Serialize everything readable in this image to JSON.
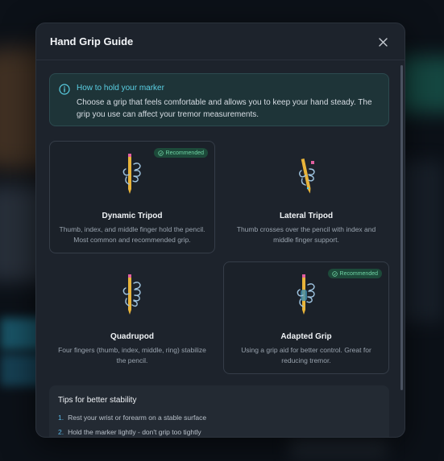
{
  "modal": {
    "title": "Hand Grip Guide",
    "close_icon": "close-icon"
  },
  "info": {
    "icon": "info-icon",
    "title": "How to hold your marker",
    "text": "Choose a grip that feels comfortable and allows you to keep your hand steady. The grip you use can affect your tremor measurements."
  },
  "grips": [
    {
      "title": "Dynamic Tripod",
      "description": "Thumb, index, and middle finger hold the pencil. Most common and recommended grip.",
      "badge": "Recommended",
      "selected": true
    },
    {
      "title": "Lateral Tripod",
      "description": "Thumb crosses over the pencil with index and middle finger support.",
      "badge": "",
      "selected": false
    },
    {
      "title": "Quadrupod",
      "description": "Four fingers (thumb, index, middle, ring) stabilize the pencil.",
      "badge": "",
      "selected": false
    },
    {
      "title": "Adapted Grip",
      "description": "Using a grip aid for better control. Great for reducing tremor.",
      "badge": "Recommended",
      "selected": true
    }
  ],
  "tips": {
    "title": "Tips for better stability",
    "items": [
      {
        "num": "1.",
        "text": "Rest your wrist or forearm on a stable surface"
      },
      {
        "num": "2.",
        "text": "Hold the marker lightly - don't grip too tightly"
      }
    ]
  },
  "colors": {
    "accent": "#5ad0e4",
    "badge_text": "#6fd3a4",
    "pencil_body": "#e8b43a",
    "pencil_eraser": "#e25fa0",
    "hand_stroke": "#9fc4e0"
  }
}
